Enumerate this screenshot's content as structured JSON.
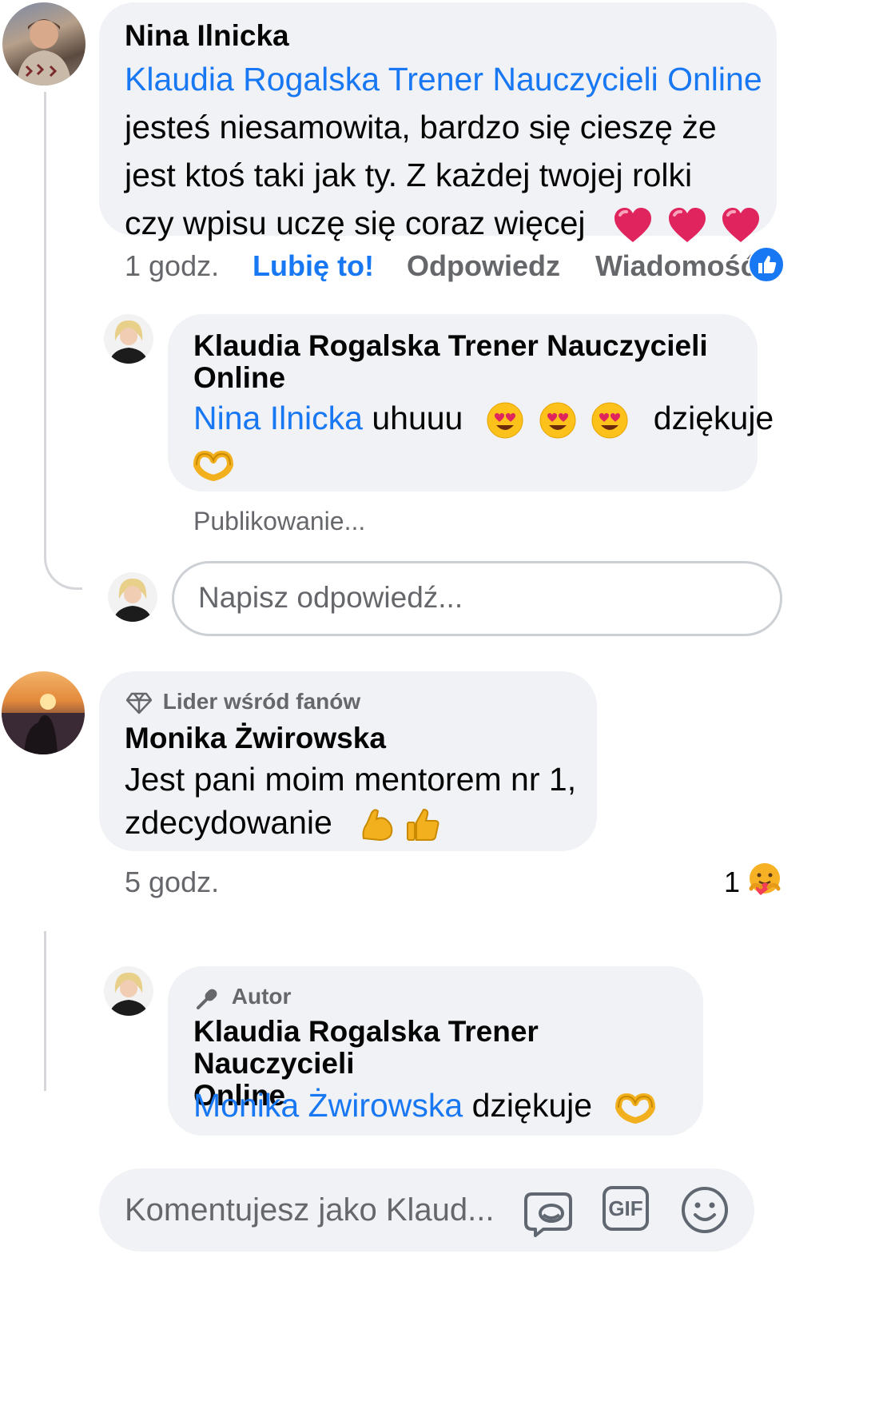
{
  "comment1": {
    "author": "Nina Ilnicka",
    "mention": "Klaudia Rogalska Trener Nauczycieli Online",
    "text_line1": "jesteś niesamowita, bardzo się cieszę że",
    "text_line2": "jest ktoś taki jak ty. Z każdej twojej rolki",
    "text_line3": "czy wpisu uczę się coraz więcej",
    "time": "1 godz.",
    "like": "Lubię to!",
    "reply": "Odpowiedz",
    "message": "Wiadomość"
  },
  "reply1": {
    "author_line1": "Klaudia Rogalska Trener Nauczycieli",
    "author_line2": "Online",
    "mention": "Nina Ilnicka",
    "text_a": "uhuuu",
    "text_b": "dziękuje",
    "status": "Publikowanie..."
  },
  "reply_box": {
    "placeholder": "Napisz odpowiedź..."
  },
  "comment2": {
    "badge": "Lider wśród fanów",
    "author": "Monika Żwirowska",
    "text_line1": "Jest pani moim mentorem nr 1,",
    "text_line2": "zdecydowanie",
    "time": "5 godz.",
    "reaction_count": "1"
  },
  "reply2": {
    "badge": "Autor",
    "author_line1": "Klaudia Rogalska Trener Nauczycieli",
    "author_line2": "Online",
    "mention": "Monika Żwirowska",
    "text": "dziękuje"
  },
  "comment_box": {
    "placeholder": "Komentujesz jako Klaud...",
    "gif_label": "GIF"
  },
  "colors": {
    "link": "#1877f2",
    "bubble": "#f0f2f5",
    "meta": "#65676b",
    "heart": "#e0245e"
  }
}
